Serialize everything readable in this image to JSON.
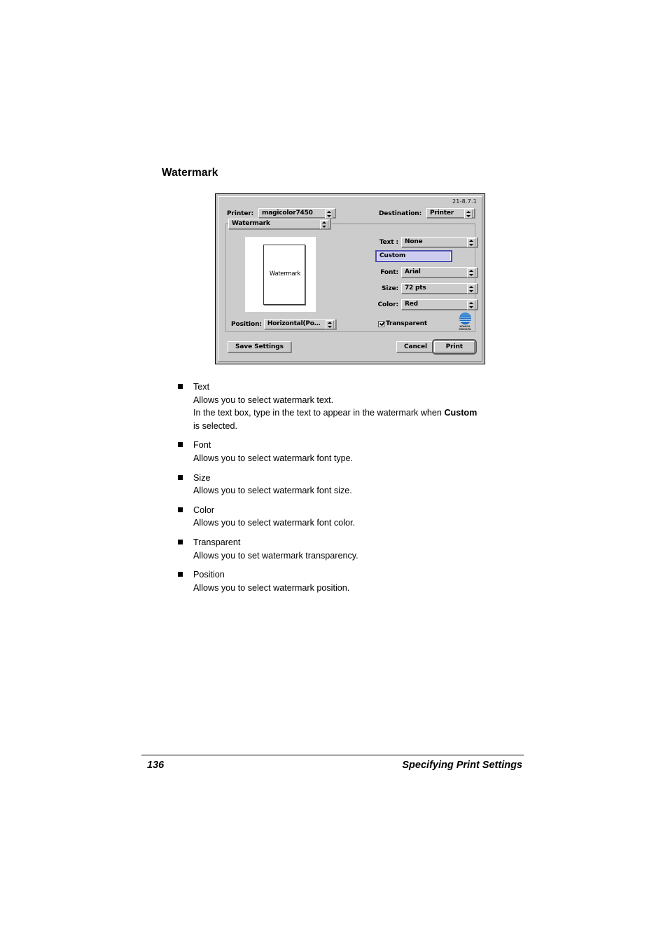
{
  "page": {
    "heading": "Watermark"
  },
  "dialog": {
    "version": "21-8.7.1",
    "printer_label": "Printer:",
    "printer_value": "magicolor7450",
    "destination_label": "Destination:",
    "destination_value": "Printer",
    "pane_value": "Watermark",
    "preview_text": "Watermark",
    "text_label": "Text :",
    "text_value": "None",
    "custom_value": "Custom",
    "font_label": "Font:",
    "font_value": "Arial",
    "size_label": "Size:",
    "size_value": "72 pts",
    "color_label": "Color:",
    "color_value": "Red",
    "position_label": "Position:",
    "position_value": "Horizontal(Po…",
    "transparent_label": "Transparent",
    "transparent_checked": true,
    "logo_text": "KONICA MINOLTA",
    "save_settings_label": "Save Settings",
    "cancel_label": "Cancel",
    "print_label": "Print",
    "accent_focus_border": "#4a4ab4",
    "accent_field_fill": "#ccccee",
    "logo_blue": "#1f6fc4",
    "chrome_gray": "#cccccc"
  },
  "bullets": [
    {
      "title": "Text",
      "line1": "Allows you to select watermark text.",
      "line2_pre": "In the text box, type in the text to appear in the watermark when ",
      "line2_bold": "Custom",
      "line3": "is selected."
    },
    {
      "title": "Font",
      "line1": "Allows you to select watermark font type."
    },
    {
      "title": "Size",
      "line1": "Allows you to select watermark font size."
    },
    {
      "title": "Color",
      "line1": "Allows you to select watermark font color."
    },
    {
      "title": "Transparent",
      "line1": "Allows you to set watermark transparency."
    },
    {
      "title": "Position",
      "line1": "Allows you to select watermark position."
    }
  ],
  "footer": {
    "page_number": "136",
    "section_title": "Specifying Print Settings"
  }
}
